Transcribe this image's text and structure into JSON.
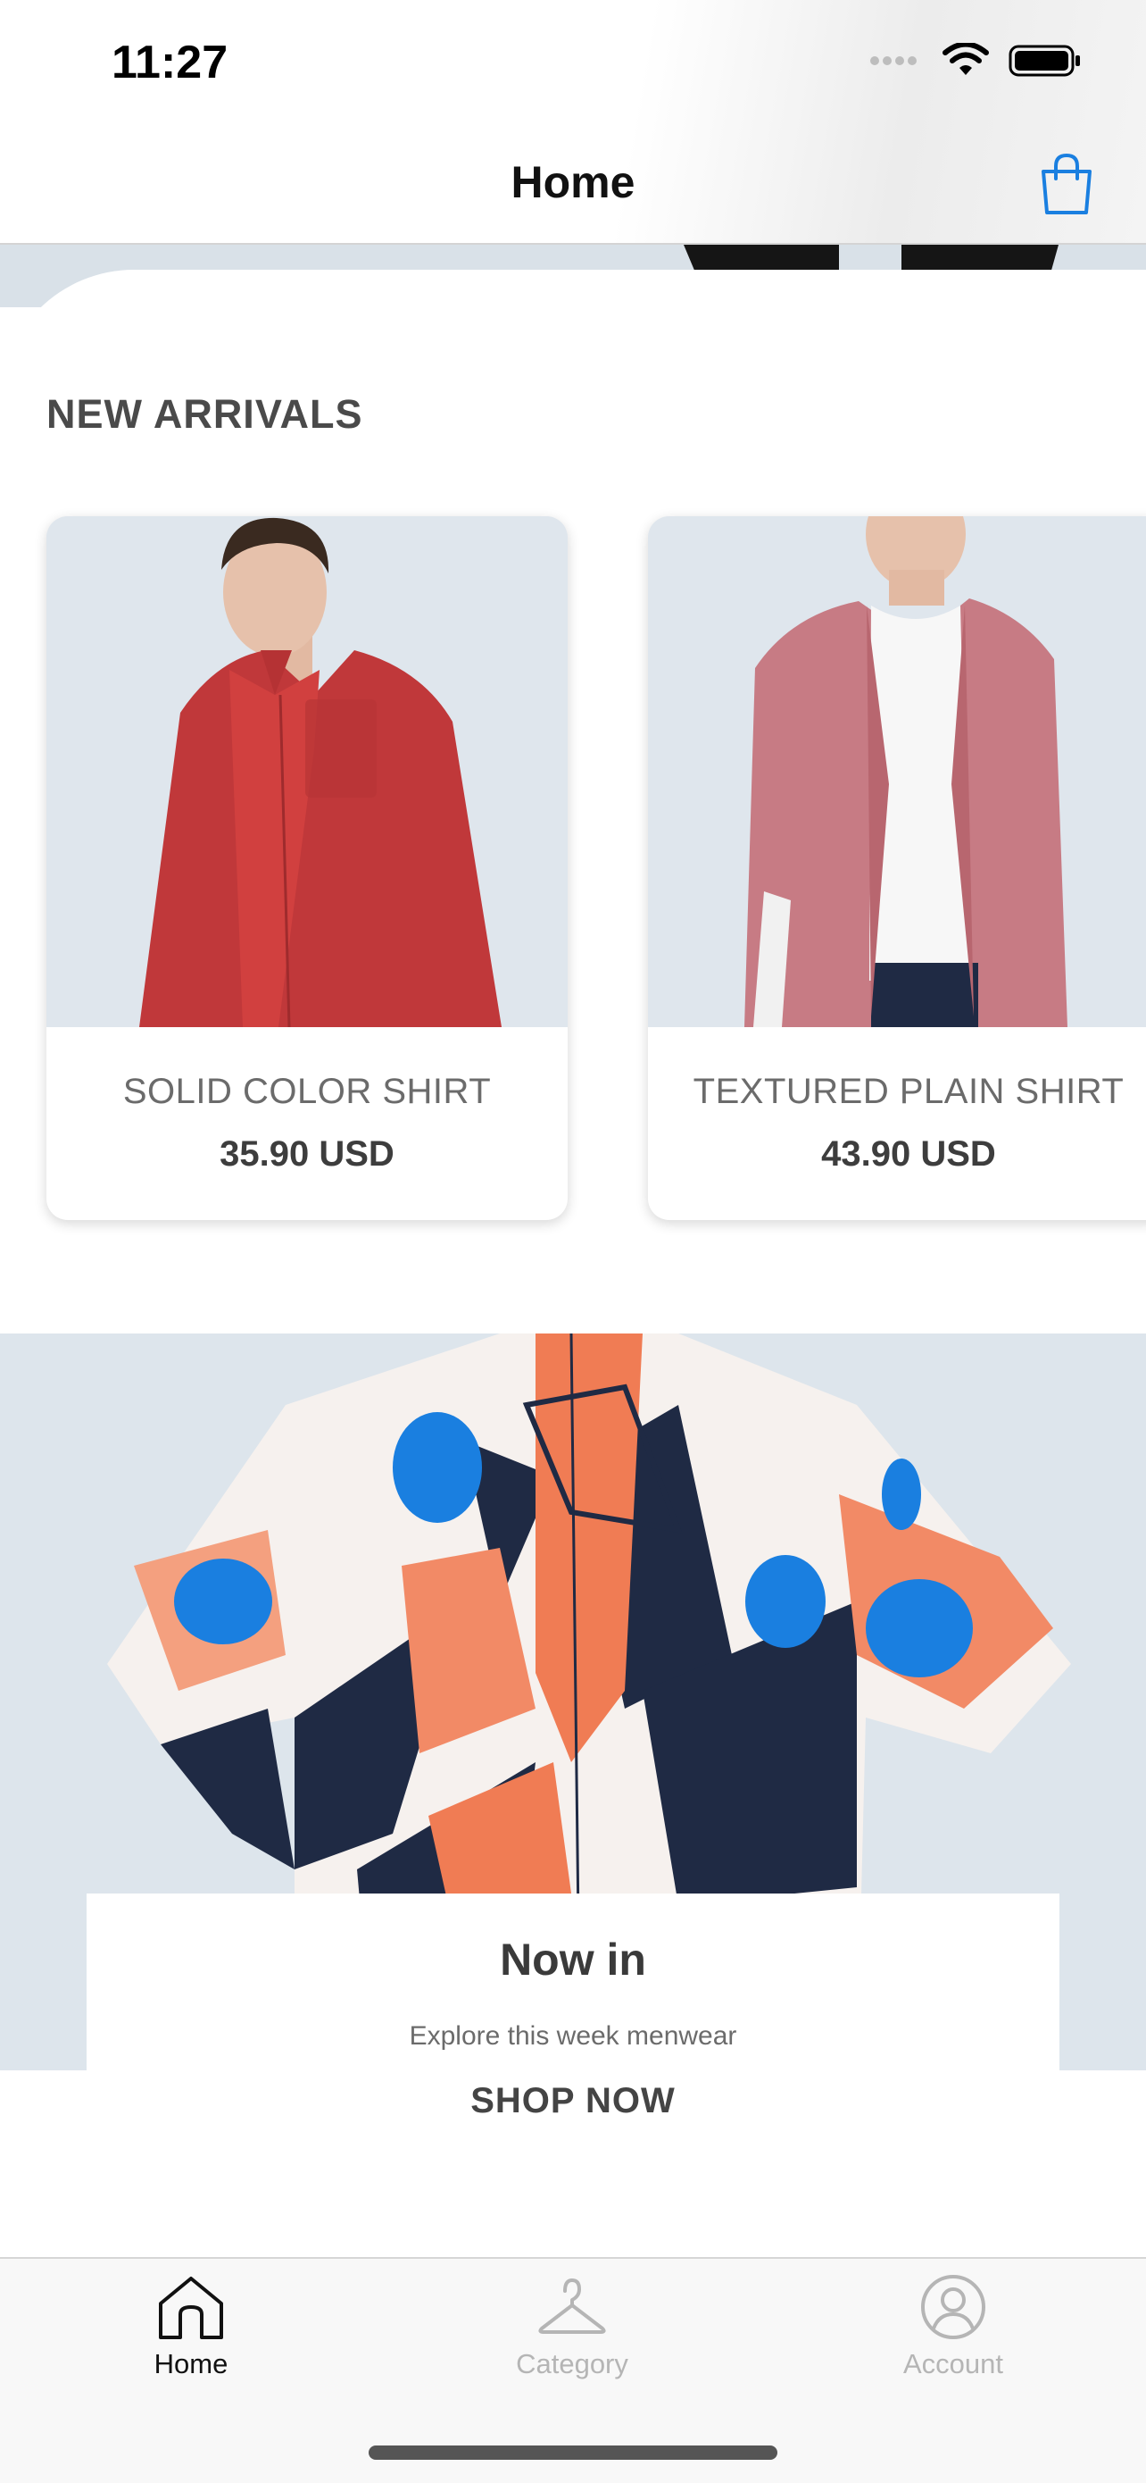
{
  "status_bar": {
    "time": "11:27"
  },
  "header": {
    "title": "Home",
    "cart_icon": "shopping-bag-icon"
  },
  "section": {
    "title": "NEW ARRIVALS"
  },
  "products": [
    {
      "name": "SOLID COLOR SHIRT",
      "price": "35.90 USD"
    },
    {
      "name": "TEXTURED PLAIN SHIRT",
      "price": "43.90 USD"
    }
  ],
  "promo": {
    "title": "Now in",
    "subtitle": "Explore this week menwear",
    "cta": "SHOP NOW"
  },
  "tabs": [
    {
      "label": "Home",
      "icon": "home-icon",
      "active": true
    },
    {
      "label": "Category",
      "icon": "hanger-icon",
      "active": false
    },
    {
      "label": "Account",
      "icon": "account-icon",
      "active": false
    }
  ],
  "colors": {
    "accent": "#1a7fe0",
    "tab_active": "#111111",
    "tab_inactive": "#b5b5b5",
    "background": "#ffffff"
  }
}
